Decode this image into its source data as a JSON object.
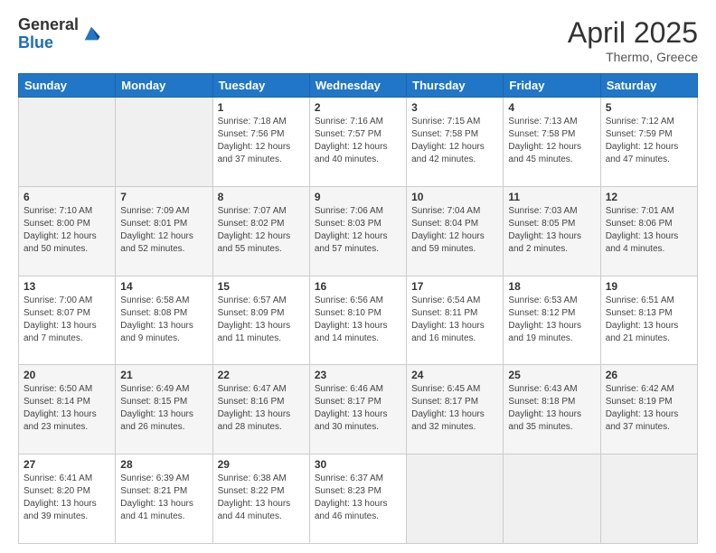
{
  "logo": {
    "general": "General",
    "blue": "Blue"
  },
  "title": {
    "month_year": "April 2025",
    "location": "Thermo, Greece"
  },
  "weekdays": [
    "Sunday",
    "Monday",
    "Tuesday",
    "Wednesday",
    "Thursday",
    "Friday",
    "Saturday"
  ],
  "weeks": [
    [
      {
        "day": "",
        "info": ""
      },
      {
        "day": "",
        "info": ""
      },
      {
        "day": "1",
        "info": "Sunrise: 7:18 AM\nSunset: 7:56 PM\nDaylight: 12 hours and 37 minutes."
      },
      {
        "day": "2",
        "info": "Sunrise: 7:16 AM\nSunset: 7:57 PM\nDaylight: 12 hours and 40 minutes."
      },
      {
        "day": "3",
        "info": "Sunrise: 7:15 AM\nSunset: 7:58 PM\nDaylight: 12 hours and 42 minutes."
      },
      {
        "day": "4",
        "info": "Sunrise: 7:13 AM\nSunset: 7:58 PM\nDaylight: 12 hours and 45 minutes."
      },
      {
        "day": "5",
        "info": "Sunrise: 7:12 AM\nSunset: 7:59 PM\nDaylight: 12 hours and 47 minutes."
      }
    ],
    [
      {
        "day": "6",
        "info": "Sunrise: 7:10 AM\nSunset: 8:00 PM\nDaylight: 12 hours and 50 minutes."
      },
      {
        "day": "7",
        "info": "Sunrise: 7:09 AM\nSunset: 8:01 PM\nDaylight: 12 hours and 52 minutes."
      },
      {
        "day": "8",
        "info": "Sunrise: 7:07 AM\nSunset: 8:02 PM\nDaylight: 12 hours and 55 minutes."
      },
      {
        "day": "9",
        "info": "Sunrise: 7:06 AM\nSunset: 8:03 PM\nDaylight: 12 hours and 57 minutes."
      },
      {
        "day": "10",
        "info": "Sunrise: 7:04 AM\nSunset: 8:04 PM\nDaylight: 12 hours and 59 minutes."
      },
      {
        "day": "11",
        "info": "Sunrise: 7:03 AM\nSunset: 8:05 PM\nDaylight: 13 hours and 2 minutes."
      },
      {
        "day": "12",
        "info": "Sunrise: 7:01 AM\nSunset: 8:06 PM\nDaylight: 13 hours and 4 minutes."
      }
    ],
    [
      {
        "day": "13",
        "info": "Sunrise: 7:00 AM\nSunset: 8:07 PM\nDaylight: 13 hours and 7 minutes."
      },
      {
        "day": "14",
        "info": "Sunrise: 6:58 AM\nSunset: 8:08 PM\nDaylight: 13 hours and 9 minutes."
      },
      {
        "day": "15",
        "info": "Sunrise: 6:57 AM\nSunset: 8:09 PM\nDaylight: 13 hours and 11 minutes."
      },
      {
        "day": "16",
        "info": "Sunrise: 6:56 AM\nSunset: 8:10 PM\nDaylight: 13 hours and 14 minutes."
      },
      {
        "day": "17",
        "info": "Sunrise: 6:54 AM\nSunset: 8:11 PM\nDaylight: 13 hours and 16 minutes."
      },
      {
        "day": "18",
        "info": "Sunrise: 6:53 AM\nSunset: 8:12 PM\nDaylight: 13 hours and 19 minutes."
      },
      {
        "day": "19",
        "info": "Sunrise: 6:51 AM\nSunset: 8:13 PM\nDaylight: 13 hours and 21 minutes."
      }
    ],
    [
      {
        "day": "20",
        "info": "Sunrise: 6:50 AM\nSunset: 8:14 PM\nDaylight: 13 hours and 23 minutes."
      },
      {
        "day": "21",
        "info": "Sunrise: 6:49 AM\nSunset: 8:15 PM\nDaylight: 13 hours and 26 minutes."
      },
      {
        "day": "22",
        "info": "Sunrise: 6:47 AM\nSunset: 8:16 PM\nDaylight: 13 hours and 28 minutes."
      },
      {
        "day": "23",
        "info": "Sunrise: 6:46 AM\nSunset: 8:17 PM\nDaylight: 13 hours and 30 minutes."
      },
      {
        "day": "24",
        "info": "Sunrise: 6:45 AM\nSunset: 8:17 PM\nDaylight: 13 hours and 32 minutes."
      },
      {
        "day": "25",
        "info": "Sunrise: 6:43 AM\nSunset: 8:18 PM\nDaylight: 13 hours and 35 minutes."
      },
      {
        "day": "26",
        "info": "Sunrise: 6:42 AM\nSunset: 8:19 PM\nDaylight: 13 hours and 37 minutes."
      }
    ],
    [
      {
        "day": "27",
        "info": "Sunrise: 6:41 AM\nSunset: 8:20 PM\nDaylight: 13 hours and 39 minutes."
      },
      {
        "day": "28",
        "info": "Sunrise: 6:39 AM\nSunset: 8:21 PM\nDaylight: 13 hours and 41 minutes."
      },
      {
        "day": "29",
        "info": "Sunrise: 6:38 AM\nSunset: 8:22 PM\nDaylight: 13 hours and 44 minutes."
      },
      {
        "day": "30",
        "info": "Sunrise: 6:37 AM\nSunset: 8:23 PM\nDaylight: 13 hours and 46 minutes."
      },
      {
        "day": "",
        "info": ""
      },
      {
        "day": "",
        "info": ""
      },
      {
        "day": "",
        "info": ""
      }
    ]
  ]
}
